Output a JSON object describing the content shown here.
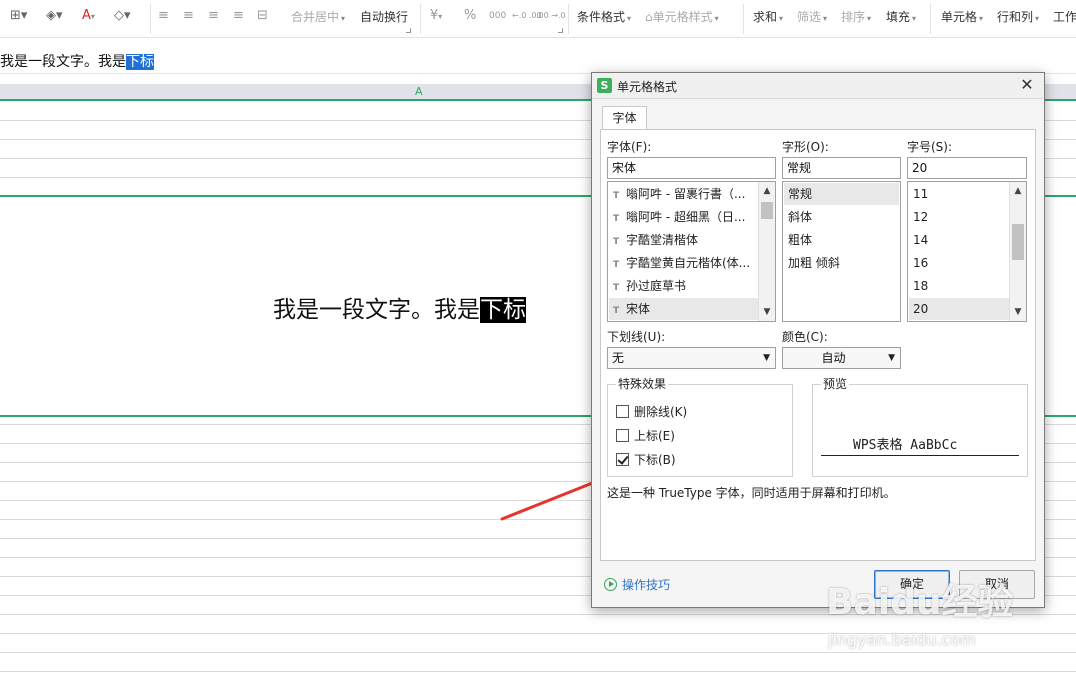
{
  "toolbar": {
    "items": [
      {
        "label": "合并居中",
        "grey": true
      },
      {
        "label": "自动换行",
        "grey": false
      },
      {
        "label": "条件格式",
        "grey": false
      },
      {
        "label": "单元格样式",
        "grey": true
      },
      {
        "label": "求和",
        "grey": false
      },
      {
        "label": "筛选",
        "grey": true
      },
      {
        "label": "排序",
        "grey": true
      },
      {
        "label": "填充",
        "grey": false
      },
      {
        "label": "单元格",
        "grey": false
      },
      {
        "label": "行和列",
        "grey": false
      },
      {
        "label": "工作表",
        "grey": false
      }
    ],
    "currency_glyph": "¥",
    "percent_glyph": "%",
    "thousands_glyph": "000",
    "dec_inc_glyph": "←.0 .00",
    "dec_dec_glyph": ".00 →.0"
  },
  "formula_bar": {
    "text_before": "我是一段文字。我是",
    "text_selected": "下标"
  },
  "sheet": {
    "column_label": "A",
    "cell_text_before": "我是一段文字。我是",
    "cell_text_selected": "下标"
  },
  "dialog": {
    "app_logo": "S",
    "title": "单元格格式",
    "tab": "字体",
    "font_label": "字体(F):",
    "font_value": "宋体",
    "font_list": [
      {
        "label": "嗡阿吽 - 留裹行書（...",
        "selected": false
      },
      {
        "label": "嗡阿吽 - 超细黑（日...",
        "selected": false
      },
      {
        "label": "字酷堂清楷体",
        "selected": false
      },
      {
        "label": "字酷堂黄自元楷体(体...",
        "selected": false
      },
      {
        "label": "孙过庭草书",
        "selected": false
      },
      {
        "label": "宋体",
        "selected": true
      }
    ],
    "style_label": "字形(O):",
    "style_value": "常规",
    "style_list": [
      {
        "label": "常规",
        "selected": true
      },
      {
        "label": "斜体",
        "selected": false
      },
      {
        "label": "粗体",
        "selected": false
      },
      {
        "label": "加粗 倾斜",
        "selected": false
      }
    ],
    "size_label": "字号(S):",
    "size_value": "20",
    "size_list": [
      {
        "label": "11",
        "selected": false
      },
      {
        "label": "12",
        "selected": false
      },
      {
        "label": "14",
        "selected": false
      },
      {
        "label": "16",
        "selected": false
      },
      {
        "label": "18",
        "selected": false
      },
      {
        "label": "20",
        "selected": true
      }
    ],
    "underline_label": "下划线(U):",
    "underline_value": "无",
    "color_label": "颜色(C):",
    "color_value": "自动",
    "effects_title": "特殊效果",
    "effects": [
      {
        "label": "删除线(K)",
        "checked": false
      },
      {
        "label": "上标(E)",
        "checked": false
      },
      {
        "label": "下标(B)",
        "checked": true
      }
    ],
    "preview_title": "预览",
    "preview_text": "WPS表格  AaBbCc",
    "description": "这是一种 TrueType 字体，同时适用于屏幕和打印机。",
    "tips_label": "操作技巧",
    "ok_label": "确定",
    "cancel_label": "取消"
  },
  "watermark": {
    "main": "Baidu经验",
    "sub": "jingyan.baidu.com"
  },
  "colors": {
    "accent_green": "#2aa86b",
    "selection_blue": "#1f6fd6",
    "arrow_red": "#e8322d",
    "link_blue": "#2f74c8"
  }
}
